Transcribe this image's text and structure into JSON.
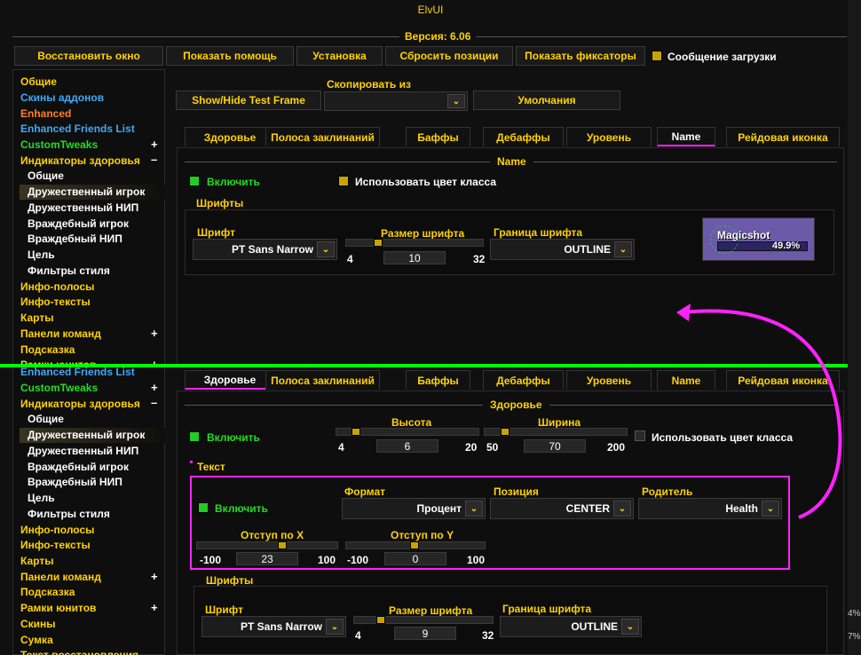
{
  "title": "ElvUI",
  "version": "Версия: 6.06",
  "topbar": {
    "restore": "Восстановить окно",
    "help": "Показать помощь",
    "install": "Установка",
    "reset": "Сбросить позиции",
    "movers": "Показать фиксаторы",
    "loginmsg": "Сообщение загрузки"
  },
  "sidebar1": {
    "general": "Общие",
    "skins_addons": "Скины аддонов",
    "enhanced": "Enhanced",
    "efl": "Enhanced Friends List",
    "ct": "CustomTweaks",
    "nameplates": "Индикаторы здоровья",
    "np_general": "Общие",
    "friendly_player": "Дружественный игрок",
    "friendly_npc": "Дружественный НИП",
    "enemy_player": "Враждебный игрок",
    "enemy_npc": "Враждебный НИП",
    "target": "Цель",
    "style_filters": "Фильтры стиля",
    "databars": "Инфо-полосы",
    "datatexts": "Инфо-тексты",
    "maps": "Карты",
    "actionbars": "Панели команд",
    "tooltip": "Подсказка",
    "unitframes": "Рамки юнитов"
  },
  "sidebar2": {
    "efl": "Enhanced Friends List",
    "ct": "CustomTweaks",
    "nameplates": "Индикаторы здоровья",
    "np_general": "Общие",
    "friendly_player": "Дружественный игрок",
    "friendly_npc": "Дружественный НИП",
    "enemy_player": "Враждебный игрок",
    "enemy_npc": "Враждебный НИП",
    "target": "Цель",
    "style_filters": "Фильтры стиля",
    "databars": "Инфо-полосы",
    "datatexts": "Инфо-тексты",
    "maps": "Карты",
    "actionbars": "Панели команд",
    "tooltip": "Подсказка",
    "unitframes": "Рамки юнитов",
    "skins": "Скины",
    "bags": "Сумка",
    "cut": "Текст восстановления"
  },
  "toolbar": {
    "testframe": "Show/Hide Test Frame",
    "copyfrom": "Скопировать из",
    "defaults": "Умолчания"
  },
  "tabs": [
    "Здоровье",
    "Полоса заклинаний",
    "Баффы",
    "Дебаффы",
    "Уровень",
    "Name",
    "Рейдовая иконка"
  ],
  "top": {
    "section": "Name",
    "enable": "Включить",
    "classcolor": "Использовать цвет класса",
    "fonts": "Шрифты",
    "font_lbl": "Шрифт",
    "font_val": "PT Sans Narrow",
    "size_lbl": "Размер шрифта",
    "size_min": "4",
    "size_val": "10",
    "size_max": "32",
    "outline_lbl": "Граница шрифта",
    "outline_val": "OUTLINE",
    "preview_name": "Magicshot",
    "preview_pct": "49.9%"
  },
  "bottom": {
    "section": "Здоровье",
    "enable": "Включить",
    "height_lbl": "Высота",
    "height_min": "4",
    "height_val": "6",
    "height_max": "20",
    "width_lbl": "Ширина",
    "width_min": "50",
    "width_val": "70",
    "width_max": "200",
    "classcolor": "Использовать цвет класса",
    "text_hdr": "Текст",
    "text_enable": "Включить",
    "format_lbl": "Формат",
    "format_val": "Процент",
    "pos_lbl": "Позиция",
    "pos_val": "CENTER",
    "parent_lbl": "Родитель",
    "parent_val": "Health",
    "xoff_lbl": "Отступ по X",
    "xoff_min": "-100",
    "xoff_val": "23",
    "xoff_max": "100",
    "yoff_lbl": "Отступ по Y",
    "yoff_min": "-100",
    "yoff_val": "0",
    "yoff_max": "100",
    "fonts": "Шрифты",
    "font_lbl": "Шрифт",
    "font_val": "PT Sans Narrow",
    "size_lbl": "Размер шрифта",
    "size_min": "4",
    "size_val": "9",
    "size_max": "32",
    "outline_lbl": "Граница шрифта",
    "outline_val": "OUTLINE"
  },
  "edge": {
    "a": "4%",
    "b": "7%"
  },
  "colors": {
    "accent": "#ffd200",
    "divider": "#00ff00",
    "annotation": "#ff22ff"
  }
}
